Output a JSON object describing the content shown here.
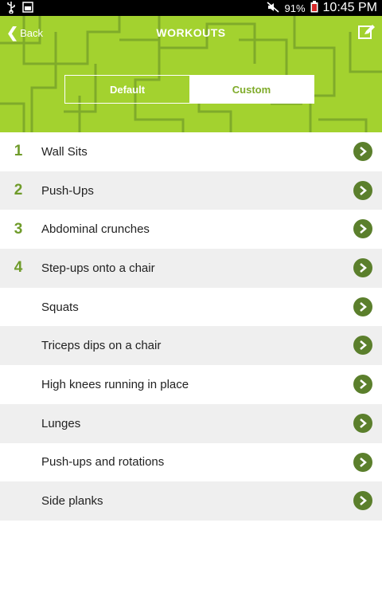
{
  "status_bar": {
    "battery": "91%",
    "time": "10:45 PM"
  },
  "header": {
    "back_label": "Back",
    "title": "WORKOUTS"
  },
  "segments": {
    "default": "Default",
    "custom": "Custom",
    "selected": "Custom"
  },
  "workouts": [
    {
      "number": "1",
      "name": "Wall Sits"
    },
    {
      "number": "2",
      "name": "Push-Ups"
    },
    {
      "number": "3",
      "name": "Abdominal crunches"
    },
    {
      "number": "4",
      "name": "Step-ups onto a chair"
    },
    {
      "number": "",
      "name": "Squats"
    },
    {
      "number": "",
      "name": "Triceps dips on a chair"
    },
    {
      "number": "",
      "name": "High knees running in place"
    },
    {
      "number": "",
      "name": "Lunges"
    },
    {
      "number": "",
      "name": "Push-ups and rotations"
    },
    {
      "number": "",
      "name": "Side planks"
    }
  ]
}
